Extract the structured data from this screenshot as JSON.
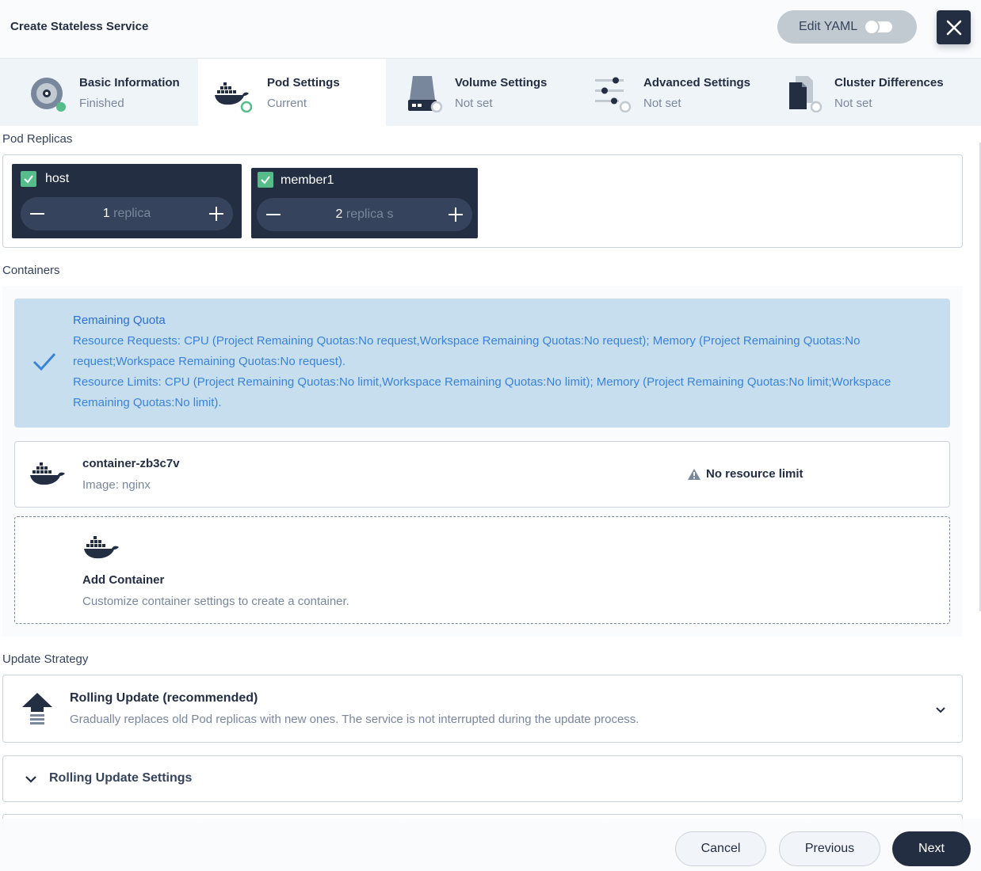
{
  "header": {
    "title": "Create Stateless Service",
    "edit_yaml_label": "Edit YAML",
    "close_icon": "close-icon"
  },
  "steps": [
    {
      "title": "Basic Information",
      "status": "Finished",
      "icon": "disk-icon"
    },
    {
      "title": "Pod Settings",
      "status": "Current",
      "icon": "docker-icon"
    },
    {
      "title": "Volume Settings",
      "status": "Not set",
      "icon": "hard-drive-icon"
    },
    {
      "title": "Advanced Settings",
      "status": "Not set",
      "icon": "sliders-icon"
    },
    {
      "title": "Cluster Differences",
      "status": "Not set",
      "icon": "files-icon"
    }
  ],
  "pod_replicas": {
    "label": "Pod Replicas",
    "clusters": [
      {
        "name": "host",
        "count": "1",
        "unit": "replica"
      },
      {
        "name": "member1",
        "count": "2",
        "unit": "replica s"
      }
    ]
  },
  "containers": {
    "label": "Containers",
    "quota": {
      "title": "Remaining Quota",
      "requests": "Resource Requests: CPU (Project Remaining Quotas:No request,Workspace Remaining Quotas:No request);  Memory (Project Remaining Quotas:No request;Workspace Remaining Quotas:No request).",
      "limits": "Resource Limits: CPU (Project Remaining Quotas:No limit,Workspace Remaining Quotas:No limit);  Memory (Project Remaining Quotas:No limit;Workspace Remaining Quotas:No limit)."
    },
    "items": [
      {
        "name": "container-zb3c7v",
        "image": "Image: nginx",
        "warning": "No resource limit"
      }
    ],
    "add": {
      "title": "Add Container",
      "description": "Customize container settings to create a container."
    }
  },
  "update_strategy": {
    "label": "Update Strategy",
    "title": "Rolling Update (recommended)",
    "description": "Gradually replaces old Pod replicas with new ones. The service is not interrupted during the update process.",
    "settings_label": "Rolling Update Settings"
  },
  "footer": {
    "cancel": "Cancel",
    "previous": "Previous",
    "next": "Next"
  },
  "colors": {
    "dark": "#242e42",
    "success": "#55bc8a",
    "info_bg": "#c7deef",
    "info_text": "#3a83d6"
  }
}
